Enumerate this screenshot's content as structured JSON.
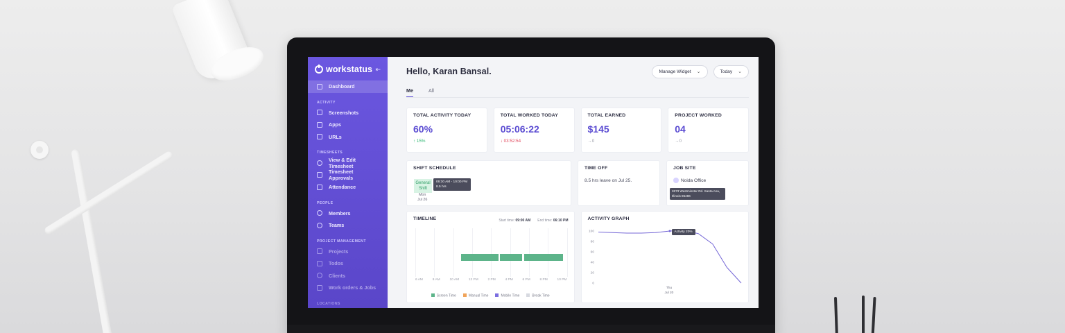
{
  "app": {
    "brand": "workstatus",
    "greeting": "Hello, Karan Bansal."
  },
  "sidebar": {
    "dashboard": "Dashboard",
    "sections": {
      "activity": "ACTIVITY",
      "timesheets": "TIMESHEETS",
      "people": "PEOPLE",
      "project_management": "PROJECT MANAGEMENT",
      "locations": "LOCATIONS"
    },
    "activity_items": [
      "Screenshots",
      "Apps",
      "URLs"
    ],
    "timesheet_items": [
      "View & Edit Timesheet",
      "Timesheet Approvals",
      "Attendance"
    ],
    "people_items": [
      "Members",
      "Teams"
    ],
    "project_items": [
      "Projects",
      "Todos",
      "Clients",
      "Work orders & Jobs"
    ]
  },
  "header": {
    "manage_widget": "Manage Widget",
    "date_filter": "Today"
  },
  "tabs": [
    "Me",
    "All"
  ],
  "stats": [
    {
      "title": "TOTAL ACTIVITY TODAY",
      "value": "60%",
      "delta": "↑ 15%",
      "trend": "up"
    },
    {
      "title": "TOTAL WORKED TODAY",
      "value": "05:06:22",
      "delta": "↓ 03:52:54",
      "trend": "down"
    },
    {
      "title": "TOTAL EARNED",
      "value": "$145",
      "delta": "→0",
      "trend": "flat"
    },
    {
      "title": "PROJECT WORKED",
      "value": "04",
      "delta": "→0",
      "trend": "flat"
    }
  ],
  "shift_schedule": {
    "title": "SHIFT SCHEDULE",
    "tag_line1": "General",
    "tag_line2": "Shift",
    "tooltip_line1": "06:30 AM - 10:00 PM",
    "tooltip_line2": "8.5 hrs",
    "day": "Mon",
    "date": "Jul 26"
  },
  "time_off": {
    "title": "TIME OFF",
    "text": "8.5 hrs leave on Jul 25."
  },
  "job_site": {
    "title": "JOB SITE",
    "name": "Noida Office",
    "tooltip_line1": "2673 Westminster Rd. Santa Ana,",
    "tooltip_line2": "Illinois 85486"
  },
  "timeline": {
    "title": "TIMELINE",
    "start_label": "Start time:",
    "start_value": "09:00 AM",
    "end_label": "End time:",
    "end_value": "06:10 PM",
    "ticks": [
      "6 AM",
      "8 AM",
      "10 AM",
      "12 PM",
      "2 PM",
      "4 PM",
      "6 PM",
      "8 PM",
      "10 PM"
    ],
    "legend": [
      {
        "label": "Screen Time",
        "color": "#5db48a"
      },
      {
        "label": "Manual Time",
        "color": "#f0a45a"
      },
      {
        "label": "Mobile Time",
        "color": "#7b6ee0"
      },
      {
        "label": "Break Time",
        "color": "#d7d9e0"
      }
    ],
    "segments": [
      {
        "start": 10.8,
        "end": 14.8
      },
      {
        "start": 14.9,
        "end": 17.3
      },
      {
        "start": 17.5,
        "end": 21.6
      }
    ]
  },
  "activity_graph": {
    "title": "ACTIVITY GRAPH",
    "tooltip": "Activity 20%",
    "x_day": "Thu",
    "x_date": "Jul 20"
  },
  "chart_data": {
    "type": "line",
    "title": "ACTIVITY GRAPH",
    "yticks": [
      "100",
      "80",
      "60",
      "40",
      "20",
      "0"
    ],
    "ylim": [
      0,
      100
    ],
    "x": [
      0,
      1,
      2,
      3,
      4,
      5,
      6,
      7,
      8,
      9,
      10
    ],
    "values": [
      98,
      97,
      96,
      96,
      97,
      100,
      101,
      95,
      75,
      30,
      0
    ]
  },
  "colors": {
    "sidebar": "#6b57e0",
    "accent": "#5a4bd2",
    "up": "#2fb673",
    "down": "#e0455a"
  }
}
